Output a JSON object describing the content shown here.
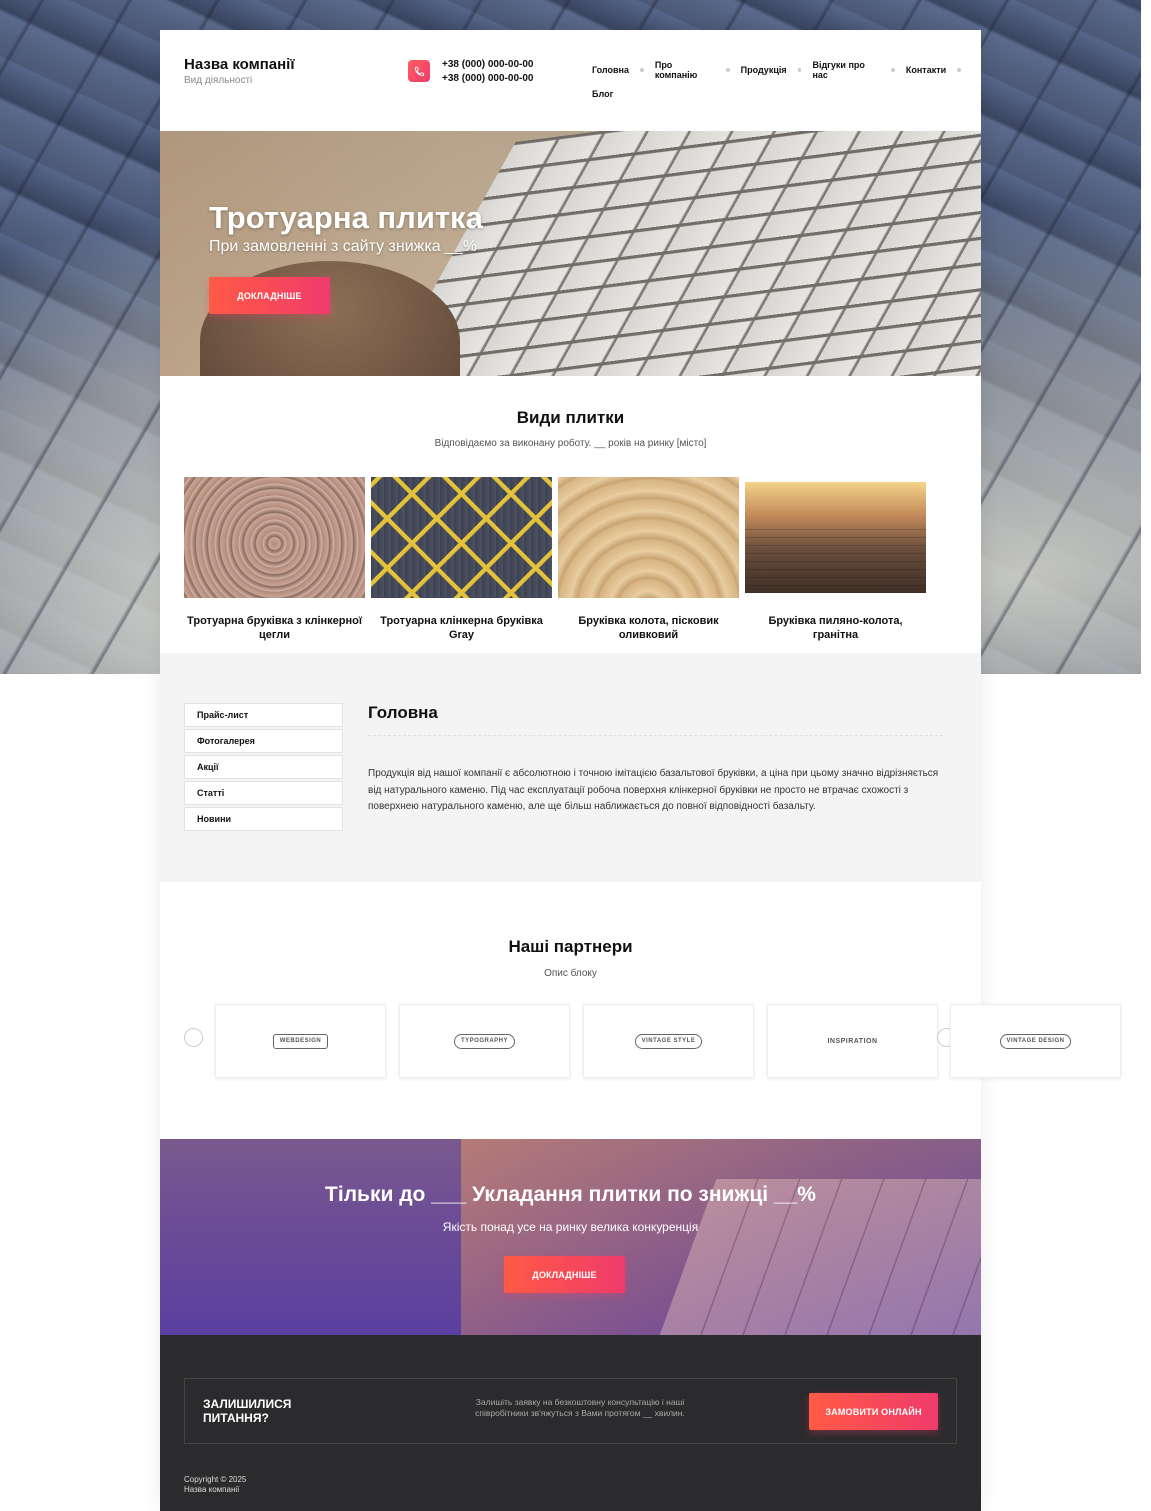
{
  "header": {
    "company_name": "Назва компанії",
    "company_sub": "Вид діяльності",
    "phones": [
      "+38 (000) 000-00-00",
      "+38 (000) 000-00-00"
    ],
    "nav": [
      "Головна",
      "Про компанію",
      "Продукція",
      "Відгуки про нас",
      "Контакти",
      "Блог"
    ]
  },
  "hero": {
    "title": "Тротуарна плитка",
    "subtitle": "При замовленні з сайту знижка __%",
    "button": "ДОКЛАДНІШЕ"
  },
  "types": {
    "title": "Види плитки",
    "subtitle": "Відповідаємо за виконану роботу. __ років на ринку [місто]",
    "items": [
      "Тротуарна бруківка з клінкерної цегли",
      "Тротуарна клінкерна бруківка Gray",
      "Бруківка колота, пісковик оливковий",
      "Бруківка пиляно-колота, гранітна"
    ]
  },
  "sidebar": {
    "items": [
      "Прайс-лист",
      "Фотогалерея",
      "Акції",
      "Статті",
      "Новини"
    ]
  },
  "content": {
    "title": "Головна",
    "text": "Продукція від нашої компанії є абсолютною і точною імітацією базальтової бруківки, а ціна при цьому значно відрізняється від натурального каменю. Під час експлуатації робоча поверхня клінкерної бруківки не просто не втрачає схожості з поверхнею натурального каменю, але ще більш наближається до повної відповідності базальту."
  },
  "partners": {
    "title": "Наші партнери",
    "subtitle": "Опис блоку",
    "logos": [
      "WEBDESIGN",
      "TYPOGRAPHY",
      "VINTAGE STYLE",
      "INSPIRATION",
      "VINTAGE DESIGN"
    ]
  },
  "promo": {
    "title": "Тільки до ___ Укладання плитки по знижці __%",
    "subtitle": "Якість понад усе на ринку велика конкуренція",
    "button": "ДОКЛАДНІШЕ"
  },
  "footer": {
    "cta_title": "ЗАЛИШИЛИСЯ ПИТАННЯ?",
    "cta_text": "Залишіть заявку на безкоштовну консультацію і наші співробітники зв'яжуться з Вами протягом __ хвилин.",
    "cta_button": "ЗАМОВИТИ ОНЛАЙН",
    "copyright": "Copyright © 2025",
    "copyright_name": "Назва компанії"
  },
  "colors": {
    "accent_start": "#ff5a45",
    "accent_end": "#ef3b6b",
    "footer_bg": "#2b2b2d",
    "gray_bg": "#f4f4f4"
  }
}
